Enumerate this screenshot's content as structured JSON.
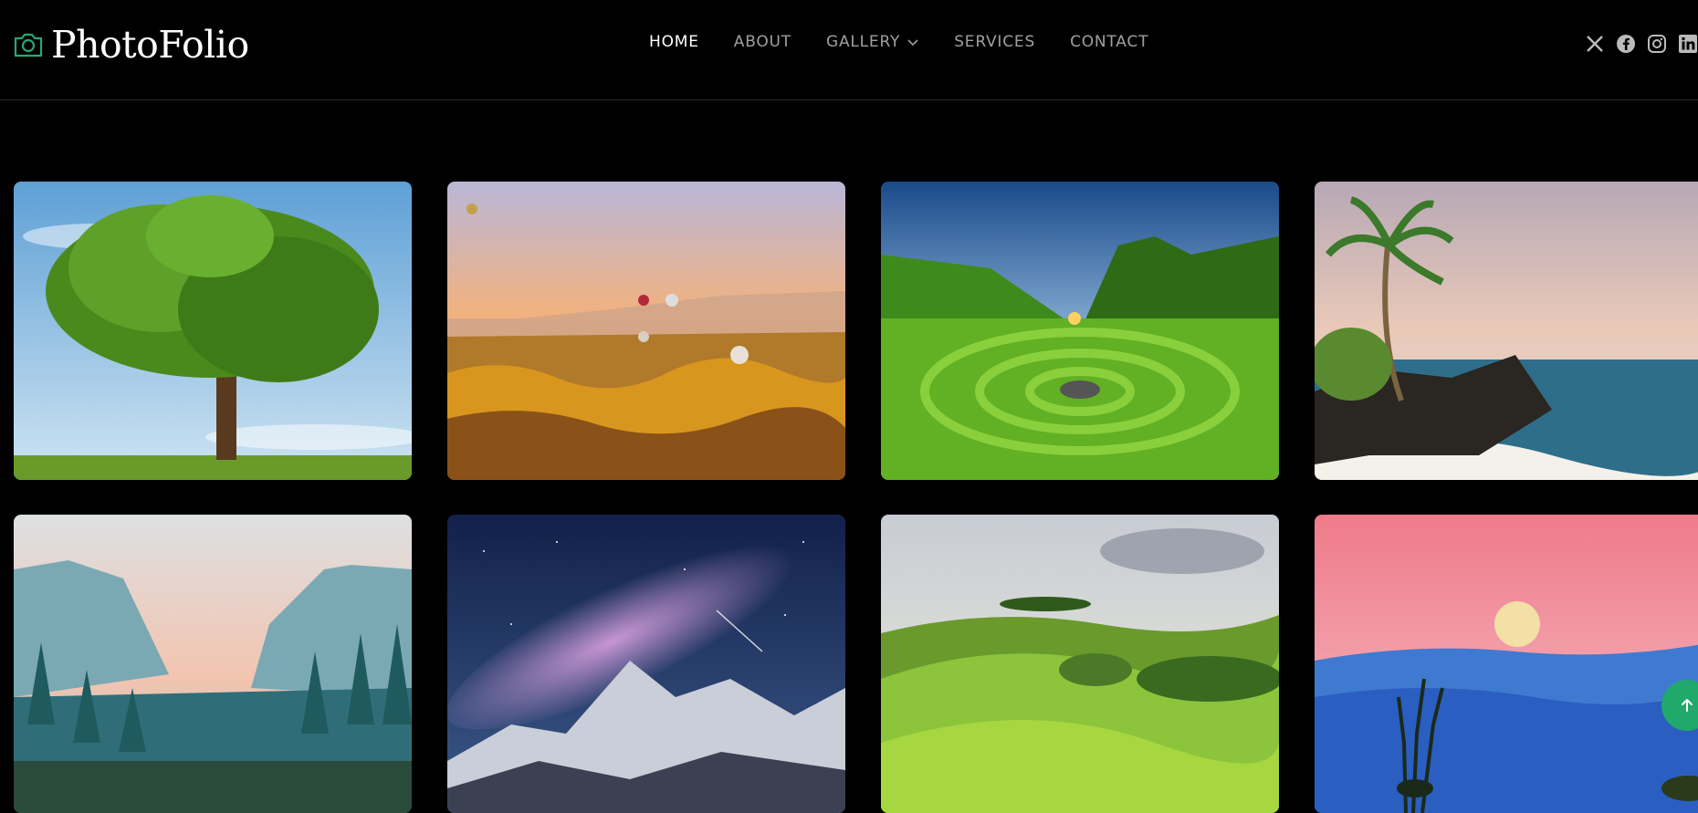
{
  "brand": {
    "name": "PhotoFolio",
    "accent": "#27a776"
  },
  "nav": {
    "items": [
      {
        "label": "HOME",
        "active": true
      },
      {
        "label": "ABOUT",
        "active": false
      },
      {
        "label": "GALLERY",
        "active": false,
        "dropdown": true
      },
      {
        "label": "SERVICES",
        "active": false
      },
      {
        "label": "CONTACT",
        "active": false
      }
    ]
  },
  "social": [
    "x-icon",
    "facebook-icon",
    "instagram-icon",
    "linkedin-icon"
  ],
  "gallery": {
    "items": [
      {
        "subject": "lone-tree"
      },
      {
        "subject": "hot-air-balloons-canyon"
      },
      {
        "subject": "spiral-green-valley-sunset"
      },
      {
        "subject": "palm-tree-rocky-beach"
      },
      {
        "subject": "misty-pine-mountains"
      },
      {
        "subject": "milky-way-snowy-peaks"
      },
      {
        "subject": "rolling-green-hills"
      },
      {
        "subject": "full-moon-pink-sky"
      }
    ]
  },
  "scroll_top": {
    "icon": "arrow-up-icon",
    "color": "#21a86b"
  }
}
